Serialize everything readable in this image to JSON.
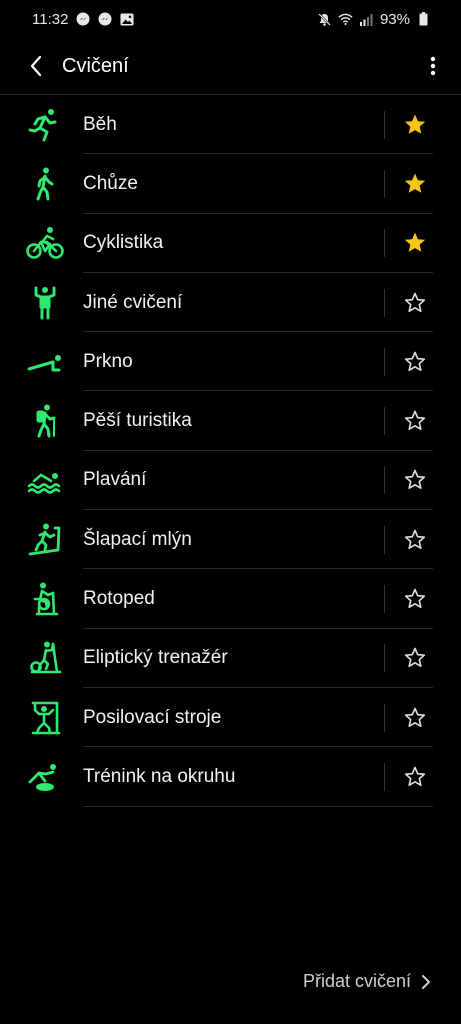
{
  "status": {
    "time": "11:32",
    "battery": "93%"
  },
  "header": {
    "title": "Cvičení"
  },
  "exercises": [
    {
      "label": "Běh",
      "icon": "running-icon",
      "favorite": true
    },
    {
      "label": "Chůze",
      "icon": "walking-icon",
      "favorite": true
    },
    {
      "label": "Cyklistika",
      "icon": "cycling-icon",
      "favorite": true
    },
    {
      "label": "Jiné cvičení",
      "icon": "other-exercise-icon",
      "favorite": false
    },
    {
      "label": "Prkno",
      "icon": "plank-icon",
      "favorite": false
    },
    {
      "label": "Pěší turistika",
      "icon": "hiking-icon",
      "favorite": false
    },
    {
      "label": "Plavání",
      "icon": "swimming-icon",
      "favorite": false
    },
    {
      "label": "Šlapací mlýn",
      "icon": "treadmill-icon",
      "favorite": false
    },
    {
      "label": "Rotoped",
      "icon": "exercise-bike-icon",
      "favorite": false
    },
    {
      "label": "Eliptický trenažér",
      "icon": "elliptical-icon",
      "favorite": false
    },
    {
      "label": "Posilovací stroje",
      "icon": "weight-machine-icon",
      "favorite": false
    },
    {
      "label": "Trénink na okruhu",
      "icon": "circuit-training-icon",
      "favorite": false
    }
  ],
  "footer": {
    "add_label": "Přidat cvičení"
  },
  "colors": {
    "accent": "#2ee86f",
    "star_filled": "#f5c518"
  }
}
